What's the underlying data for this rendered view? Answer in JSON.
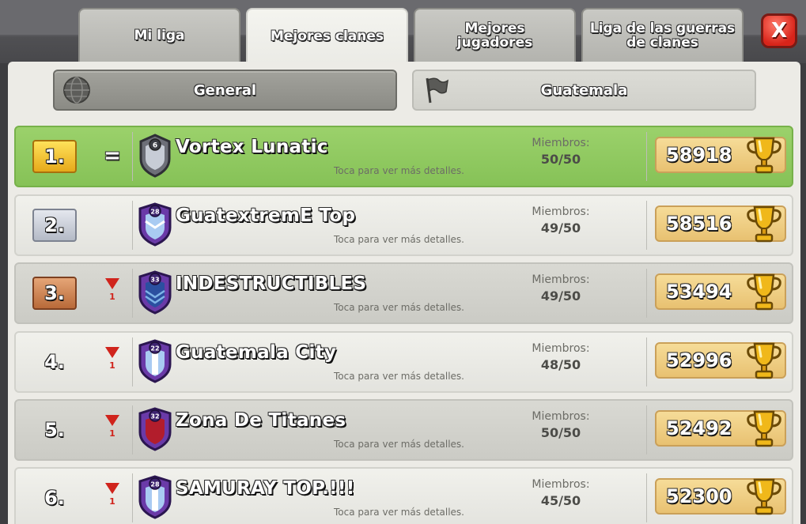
{
  "tabs": [
    {
      "label": "Mi liga",
      "active": false
    },
    {
      "label": "Mejores clanes",
      "active": true
    },
    {
      "label": "Mejores jugadores",
      "active": false
    },
    {
      "label": "Liga de las guerras de clanes",
      "active": false
    }
  ],
  "close_label": "X",
  "filters": {
    "general_label": "General",
    "country_label": "Guatemala"
  },
  "rows": [
    {
      "rank": "1.",
      "change": "=",
      "change_num": "",
      "shield_level": "6",
      "name": "Vortex Lunatic",
      "hint": "Toca para ver más detalles.",
      "members_label": "Miembros:",
      "members": "50/50",
      "trophies": "58918"
    },
    {
      "rank": "2.",
      "change": "",
      "change_num": "",
      "shield_level": "28",
      "name": "GuatextremE Top",
      "hint": "Toca para ver más detalles.",
      "members_label": "Miembros:",
      "members": "49/50",
      "trophies": "58516"
    },
    {
      "rank": "3.",
      "change": "down",
      "change_num": "1",
      "shield_level": "33",
      "name": "INDESTRUCTIBLES",
      "hint": "Toca para ver más detalles.",
      "members_label": "Miembros:",
      "members": "49/50",
      "trophies": "53494"
    },
    {
      "rank": "4.",
      "change": "down",
      "change_num": "1",
      "shield_level": "22",
      "name": "Guatemala City",
      "hint": "Toca para ver más detalles.",
      "members_label": "Miembros:",
      "members": "48/50",
      "trophies": "52996"
    },
    {
      "rank": "5.",
      "change": "down",
      "change_num": "1",
      "shield_level": "32",
      "name": "Zona De Titanes",
      "hint": "Toca para ver más detalles.",
      "members_label": "Miembros:",
      "members": "50/50",
      "trophies": "52492"
    },
    {
      "rank": "6.",
      "change": "down",
      "change_num": "1",
      "shield_level": "28",
      "name": "SAMURAY TOP.!!!",
      "hint": "Toca para ver más detalles.",
      "members_label": "Miembros:",
      "members": "45/50",
      "trophies": "52300"
    }
  ],
  "colors": {
    "first_row": "#8fc85f",
    "gold_badge": "#f2c431",
    "silver_badge": "#c9ced8",
    "bronze_badge": "#cc8150",
    "trophy_box": "#efcd84",
    "close_button": "#e5352a"
  },
  "icons": {
    "general": "globe-icon",
    "country": "flag-icon",
    "trophy": "trophy-icon",
    "rank_change_down": "triangle-down-icon"
  }
}
